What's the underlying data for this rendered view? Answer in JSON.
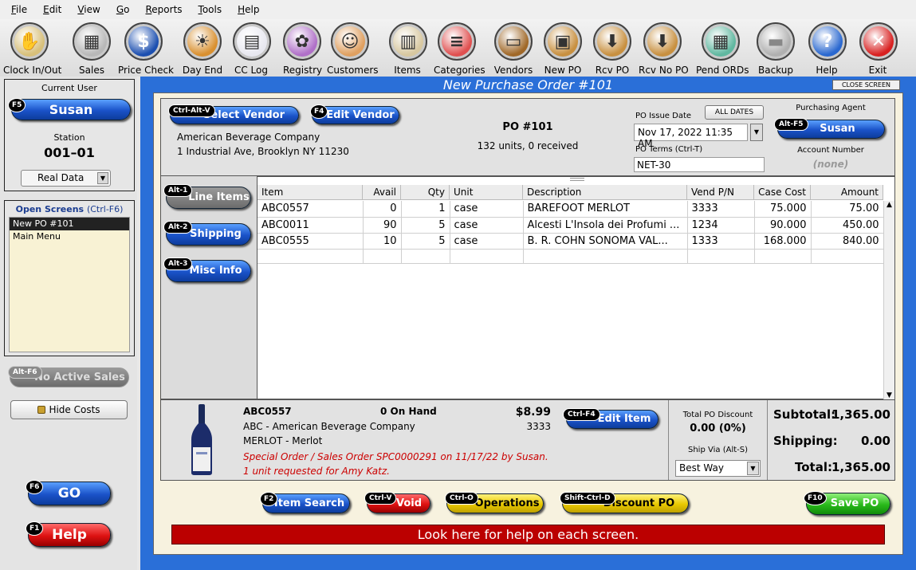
{
  "menu": [
    "File",
    "Edit",
    "View",
    "Go",
    "Reports",
    "Tools",
    "Help"
  ],
  "toolbar": [
    {
      "label": "Clock In/Out",
      "icon": "clock-icon",
      "glyph": "✋",
      "color": "#d8c07a"
    },
    {
      "label": "Sales",
      "icon": "register-icon",
      "glyph": "▦",
      "color": "#b8b8b8"
    },
    {
      "label": "Price Check",
      "icon": "dollar-icon",
      "glyph": "$",
      "color": "#1c4fb0"
    },
    {
      "label": "Day End",
      "icon": "sunset-icon",
      "glyph": "☀",
      "color": "#d99030"
    },
    {
      "label": "CC Log",
      "icon": "document-icon",
      "glyph": "▤",
      "color": "#e8e8f0"
    },
    {
      "label": "Registry",
      "icon": "gift-icon",
      "glyph": "✿",
      "color": "#b070c8"
    },
    {
      "label": "Customers",
      "icon": "customer-icon",
      "glyph": "☺",
      "color": "#e0a060"
    },
    {
      "label": "Items",
      "icon": "items-icon",
      "glyph": "▥",
      "color": "#d8c8a0"
    },
    {
      "label": "Categories",
      "icon": "categories-icon",
      "glyph": "≡",
      "color": "#e05050"
    },
    {
      "label": "Vendors",
      "icon": "briefcase-icon",
      "glyph": "▭",
      "color": "#a06828"
    },
    {
      "label": "New PO",
      "icon": "boxes-icon",
      "glyph": "▣",
      "color": "#c89040"
    },
    {
      "label": "Rcv PO",
      "icon": "receive-po-icon",
      "glyph": "⬇",
      "color": "#c89040"
    },
    {
      "label": "Rcv No PO",
      "icon": "receive-no-po-icon",
      "glyph": "⬇",
      "color": "#c89040"
    },
    {
      "label": "Pend ORDs",
      "icon": "pending-orders-icon",
      "glyph": "▦",
      "color": "#60b8a0"
    },
    {
      "label": "Backup",
      "icon": "backup-icon",
      "glyph": "▬",
      "color": "#b0b0b0"
    },
    {
      "label": "Help",
      "icon": "help-icon",
      "glyph": "?",
      "color": "#2a68d0"
    },
    {
      "label": "Exit",
      "icon": "exit-icon",
      "glyph": "✕",
      "color": "#d82020"
    }
  ],
  "left": {
    "current_user_label": "Current User",
    "user_key": "F5",
    "user_name": "Susan",
    "station_label": "Station",
    "station": "001–01",
    "data_mode": "Real Data",
    "open_screens_title": "Open Screens",
    "open_screens_hint": "(Ctrl-F6)",
    "open_screens": [
      "New PO #101",
      "Main Menu"
    ],
    "no_sales_key": "Alt-F6",
    "no_sales": "No Active Sales",
    "hide_costs": "Hide Costs",
    "go_key": "F6",
    "go": "GO",
    "help_key": "F1",
    "help": "Help"
  },
  "window": {
    "title": "New Purchase Order #101",
    "close": "CLOSE SCREEN"
  },
  "header": {
    "select_vendor_key": "Ctrl-Alt-V",
    "select_vendor": "Select Vendor",
    "edit_vendor_key": "F4",
    "edit_vendor": "Edit Vendor",
    "vendor_name": "American Beverage Company",
    "vendor_address": "1 Industrial Ave, Brooklyn NY  11230",
    "po_number": "PO #101",
    "po_units": "132 units, 0 received",
    "issue_date_label": "PO Issue Date",
    "all_dates": "ALL DATES",
    "issue_date": "Nov 17, 2022 11:35 AM",
    "terms_label": "PO Terms (Ctrl-T)",
    "terms": "NET-30",
    "agent_label": "Purchasing Agent",
    "agent_key": "Alt-F5",
    "agent": "Susan",
    "account_label": "Account Number",
    "account": "(none)"
  },
  "tabs": [
    {
      "key": "Alt-1",
      "label": "Line Items"
    },
    {
      "key": "Alt-2",
      "label": "Shipping"
    },
    {
      "key": "Alt-3",
      "label": "Misc Info"
    }
  ],
  "grid": {
    "columns": [
      "Item",
      "Avail",
      "Qty",
      "Unit",
      "Description",
      "Vend P/N",
      "Case Cost",
      "Amount"
    ],
    "rows": [
      [
        "ABC0557",
        "0",
        "1",
        "case",
        "BAREFOOT MERLOT",
        "3333",
        "75.000",
        "75.00"
      ],
      [
        "ABC0011",
        "90",
        "5",
        "case",
        "Alcesti L'Insola dei Profumi ...",
        "1234",
        "90.000",
        "450.00"
      ],
      [
        "ABC0555",
        "10",
        "5",
        "case",
        "B. R. COHN SONOMA VAL...",
        "1333",
        "168.000",
        "840.00"
      ]
    ]
  },
  "detail": {
    "item": "ABC0557",
    "on_hand": "0 On Hand",
    "price": "$8.99",
    "vendor": "ABC - American Beverage Company",
    "vend_pn": "3333",
    "category": "MERLOT - Merlot",
    "note1": "Special Order / Sales Order SPC0000291 on 11/17/22 by Susan.",
    "note2": "1 unit requested for Amy Katz.",
    "edit_item_key": "Ctrl-F4",
    "edit_item": "Edit Item",
    "discount_label": "Total PO Discount",
    "discount": "0.00 (0%)",
    "ship_via_label": "Ship Via (Alt-S)",
    "ship_via": "Best Way"
  },
  "totals": {
    "subtotal_label": "Subtotal:",
    "subtotal": "1,365.00",
    "shipping_label": "Shipping:",
    "shipping": "0.00",
    "total_label": "Total:",
    "total": "1,365.00"
  },
  "bottom": {
    "item_search_key": "F2",
    "item_search": "Item Search",
    "void_key": "Ctrl-V",
    "void": "Void",
    "operations_key": "Ctrl-O",
    "operations": "Operations",
    "discount_key": "Shift-Ctrl-D",
    "discount": "Discount PO",
    "save_key": "F10",
    "save": "Save PO",
    "help_bar": "Look here for help on each screen."
  }
}
